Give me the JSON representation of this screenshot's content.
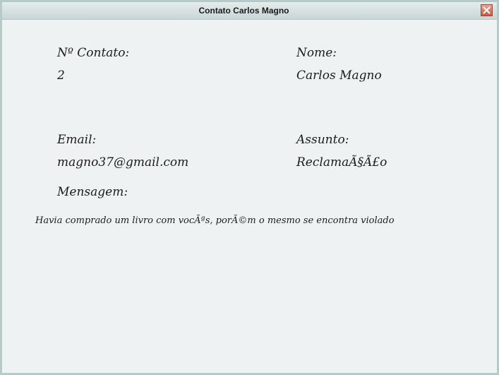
{
  "window": {
    "title": "Contato Carlos Magno"
  },
  "fields": {
    "numero_label": "Nº Contato:",
    "numero_value": "2",
    "nome_label": "Nome:",
    "nome_value": "Carlos Magno",
    "email_label": "Email:",
    "email_value": "magno37@gmail.com",
    "assunto_label": "Assunto:",
    "assunto_value": "ReclamaÃ§Ã£o",
    "mensagem_label": "Mensagem:",
    "mensagem_value": "Havia comprado um livro com vocÃªs, porÃ©m o mesmo se encontra violado"
  },
  "icons": {
    "close": "close-icon"
  },
  "colors": {
    "window_background": "#eef2f3",
    "titlebar": "#c9d6d5",
    "close_button": "#d4553c"
  }
}
